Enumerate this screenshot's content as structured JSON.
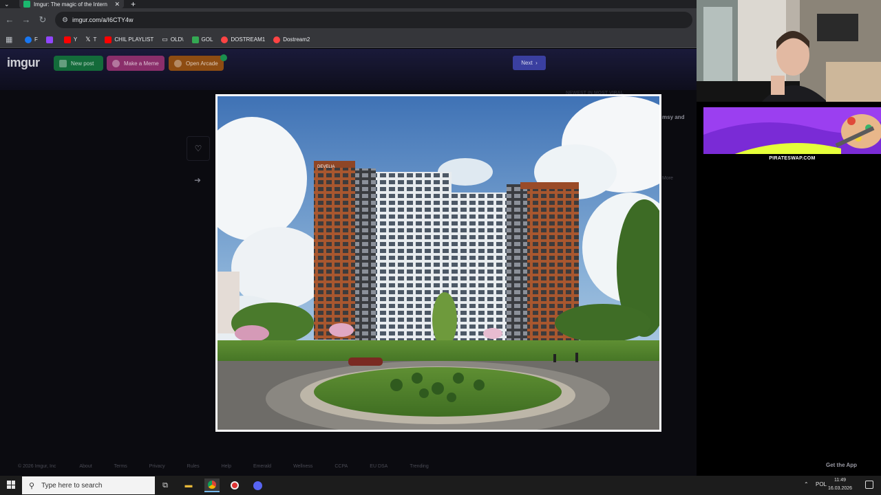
{
  "browser": {
    "tab_title": "Imgur: The magic of the Intern",
    "url": "imgur.com/a/I6CTY4w",
    "bookmarks": [
      {
        "label": "F",
        "color": "#1877f2"
      },
      {
        "label": "",
        "color": "#9146ff"
      },
      {
        "label": "Y",
        "color": "#ff0000"
      },
      {
        "label": "T",
        "color": "#ffffff"
      },
      {
        "label": "CHIL PLAYLIST",
        "color": "#ff0000"
      },
      {
        "label": "OLD\\",
        "color": "#e8eaed"
      },
      {
        "label": "GOL",
        "color": "#34a853"
      },
      {
        "label": "DOSTREAM1",
        "color": "#ff4444"
      },
      {
        "label": "Dostream2",
        "color": "#ff4444"
      }
    ]
  },
  "imgur": {
    "logo": "imgur",
    "new_post": "New post",
    "make_meme": "Make a Meme",
    "open_arcade": "Open Arcade",
    "next": "Next",
    "side_heading": "NEWEST IN MOST VIRAL",
    "side_snippet": "msy and",
    "side_more": "More",
    "image_alt": "Architectural rendering of a high-rise residential building with roundabout and trees",
    "building_sign": "DEVELIA"
  },
  "footer": {
    "links": [
      "© 2026 Imgur, Inc",
      "About",
      "Terms",
      "Privacy",
      "Rules",
      "Help",
      "Emerald",
      "Wellness",
      "CCPA",
      "EU DSA",
      "Trending"
    ],
    "get_app": "Get the App"
  },
  "stream": {
    "promo_label": "PIRATESWAP.COM"
  },
  "taskbar": {
    "search_placeholder": "Type here to search",
    "language": "POL",
    "time": "11:49",
    "date": "16.03.2026"
  }
}
